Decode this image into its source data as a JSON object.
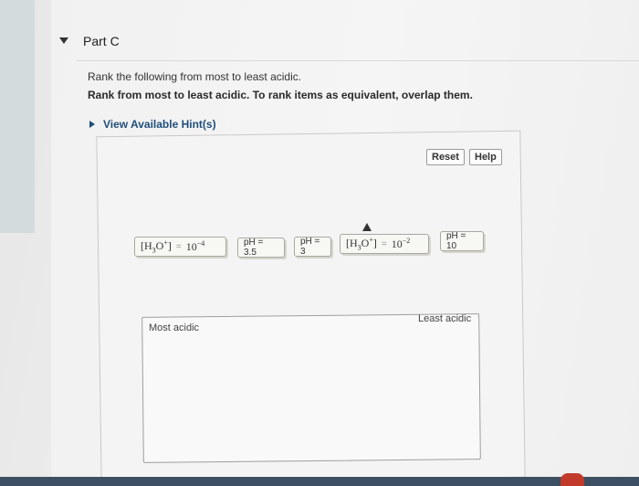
{
  "part": {
    "title": "Part C"
  },
  "question": {
    "line1": "Rank the following from most to least acidic.",
    "line2": "Rank from most to least acidic. To rank items as equivalent, overlap them."
  },
  "hints": {
    "label": "View Available Hint(s)"
  },
  "toolbar": {
    "reset_label": "Reset",
    "help_label": "Help"
  },
  "tiles": [
    {
      "left": "[H",
      "sub": "3",
      "mid": "O",
      "sup1": "+",
      "right": "]",
      "eq": "=",
      "base": "10",
      "exp": "−4"
    },
    {
      "label": "pH = 3.5"
    },
    {
      "label": "pH = 3"
    },
    {
      "left": "[H",
      "sub": "3",
      "mid": "O",
      "sup1": "+",
      "right": "]",
      "eq": "=",
      "base": "10",
      "exp": "−2"
    },
    {
      "label": "pH = 10"
    }
  ],
  "dropzone": {
    "most_label": "Most acidic",
    "least_label": "Least acidic"
  }
}
